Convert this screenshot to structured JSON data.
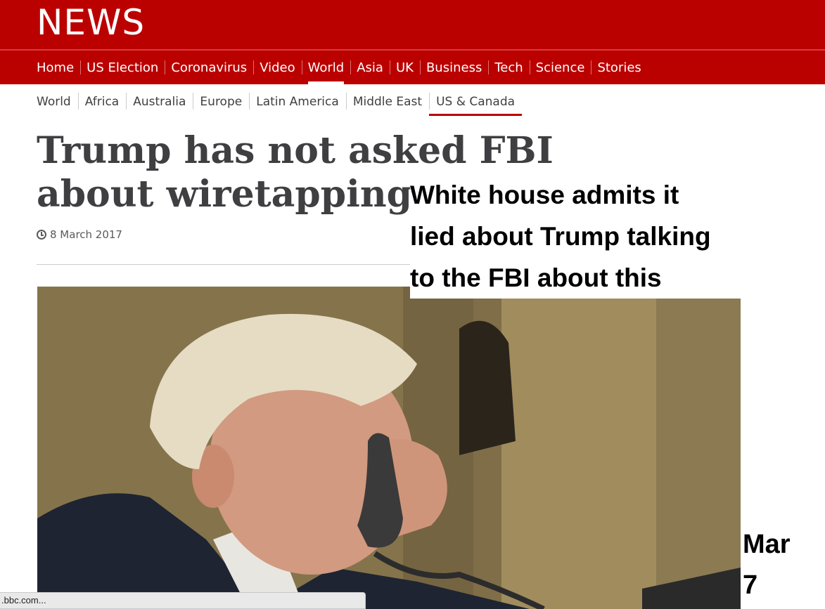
{
  "masthead": {
    "logo": "NEWS",
    "brand_color": "#bb0000"
  },
  "primary_nav": {
    "items": [
      {
        "label": "Home"
      },
      {
        "label": "US Election"
      },
      {
        "label": "Coronavirus"
      },
      {
        "label": "Video"
      },
      {
        "label": "World",
        "active": true
      },
      {
        "label": "Asia"
      },
      {
        "label": "UK"
      },
      {
        "label": "Business"
      },
      {
        "label": "Tech"
      },
      {
        "label": "Science"
      },
      {
        "label": "Stories"
      }
    ]
  },
  "secondary_nav": {
    "items": [
      {
        "label": "World"
      },
      {
        "label": "Africa"
      },
      {
        "label": "Australia"
      },
      {
        "label": "Europe"
      },
      {
        "label": "Latin America"
      },
      {
        "label": "Middle East"
      },
      {
        "label": "US & Canada",
        "active": true
      }
    ]
  },
  "article": {
    "headline": "Trump has not asked FBI about wiretapping claims",
    "date": "8 March 2017",
    "clock_icon": "clock-icon"
  },
  "overlay": {
    "caption": "White house admits it\nlied about Trump talking\nto the FBI about this",
    "date_note": "Mar\n7"
  },
  "status_bar": {
    "url": ".bbc.com..."
  }
}
